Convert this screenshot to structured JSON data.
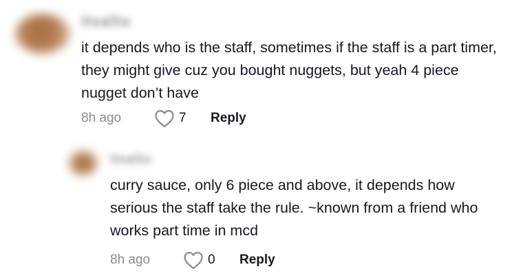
{
  "comments": [
    {
      "username": "itsaltu",
      "text": "it depends who is the staff, sometimes if the staff is a part timer, they might give cuz you bought nuggets, but yeah 4 piece nugget don’t have",
      "time": "8h ago",
      "likes": "7",
      "reply_label": "Reply",
      "icon": "heart-outline-icon"
    },
    {
      "username": "itsaltu",
      "text": "curry sauce, only 6 piece and above, it depends how serious the staff take the rule. ~known from a friend who works part time in mcd",
      "time": "8h ago",
      "likes": "0",
      "reply_label": "Reply",
      "icon": "heart-outline-icon"
    }
  ],
  "colors": {
    "text": "#161823",
    "muted": "#8a8b91",
    "icon_stroke": "#8a8b91"
  }
}
